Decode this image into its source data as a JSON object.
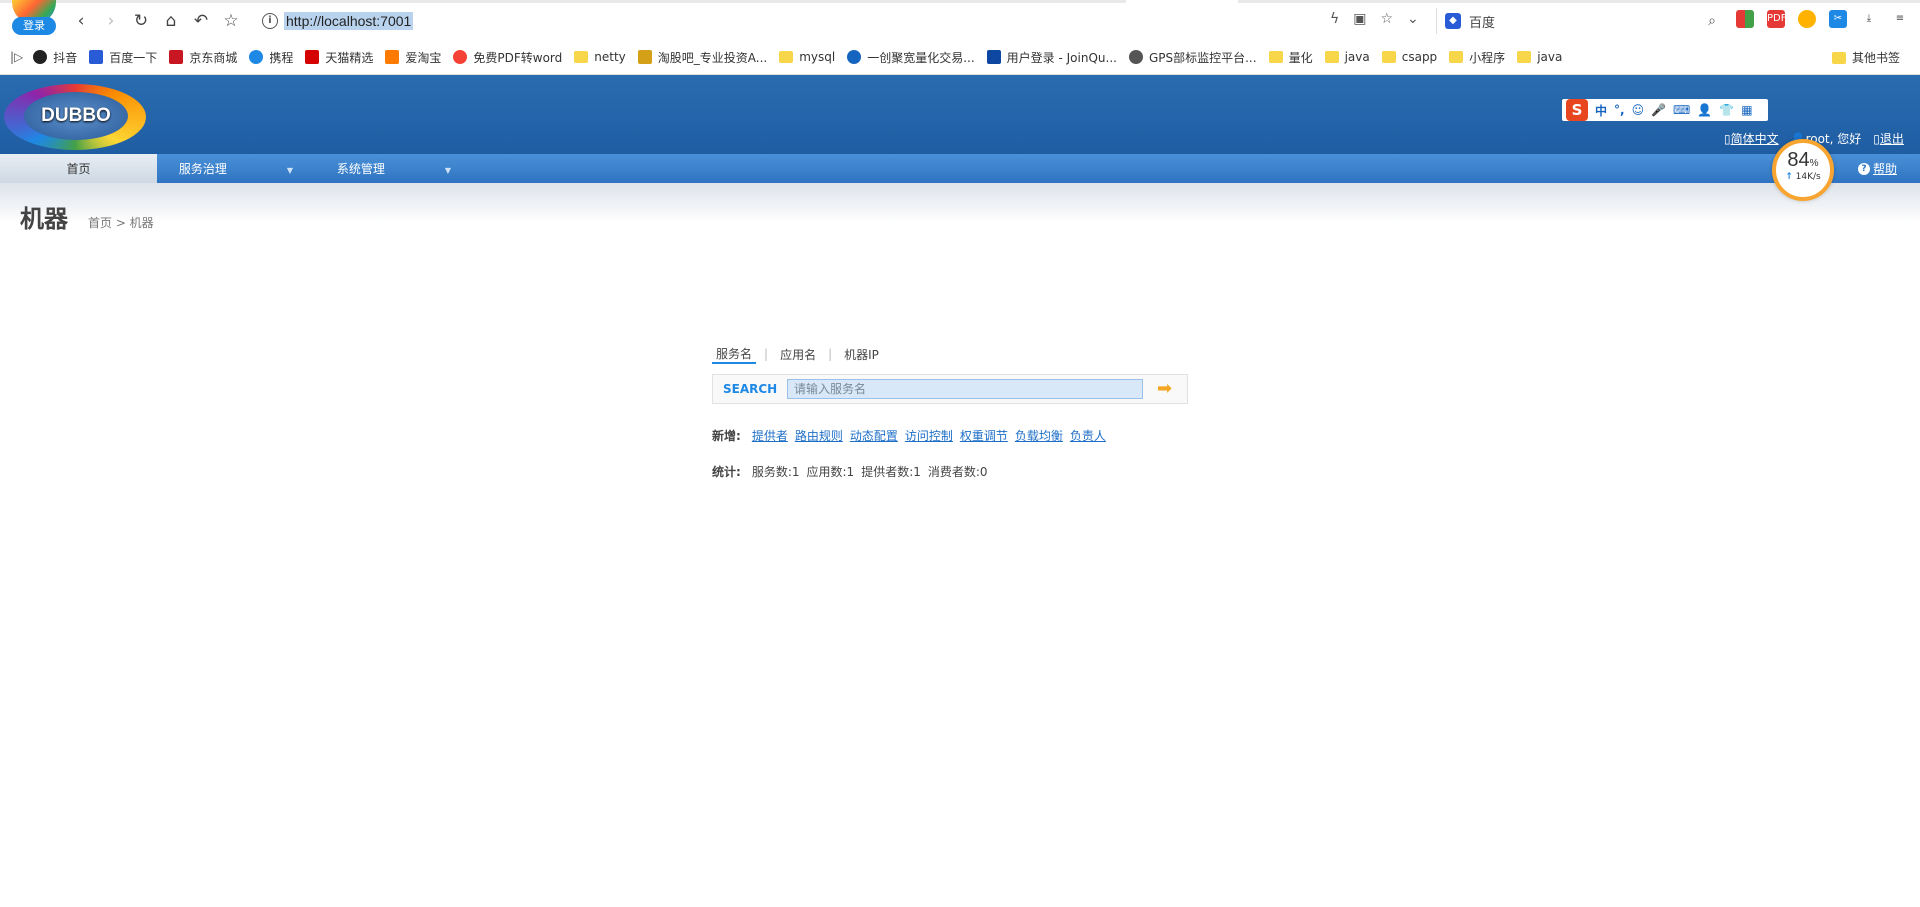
{
  "browser": {
    "login_label": "登录",
    "url": "http://localhost:7001",
    "search_engine": "百度",
    "bookmarks": [
      {
        "label": "抖音",
        "icon": "douyin-icon"
      },
      {
        "label": "百度一下",
        "icon": "baidu-icon"
      },
      {
        "label": "京东商城",
        "icon": "jd-icon"
      },
      {
        "label": "携程",
        "icon": "ctrip-icon"
      },
      {
        "label": "天猫精选",
        "icon": "tmall-icon"
      },
      {
        "label": "爱淘宝",
        "icon": "taobao-icon"
      },
      {
        "label": "免费PDF转word",
        "icon": "pdf-icon"
      },
      {
        "label": "netty",
        "icon": "folder-icon"
      },
      {
        "label": "淘股吧_专业投资A...",
        "icon": "taoguba-icon"
      },
      {
        "label": "mysql",
        "icon": "folder-icon"
      },
      {
        "label": "一创聚宽量化交易...",
        "icon": "joinquant-icon"
      },
      {
        "label": "用户登录 - JoinQu...",
        "icon": "joinquant-chart-icon"
      },
      {
        "label": "GPS部标监控平台...",
        "icon": "globe-icon"
      },
      {
        "label": "量化",
        "icon": "folder-icon"
      },
      {
        "label": "java",
        "icon": "folder-icon"
      },
      {
        "label": "csapp",
        "icon": "folder-icon"
      },
      {
        "label": "小程序",
        "icon": "folder-icon"
      },
      {
        "label": "java",
        "icon": "folder-icon"
      }
    ],
    "other_bookmarks": "其他书签"
  },
  "header": {
    "logo_text": "DUBBO",
    "lang_label": "简体中文",
    "greeting": "root, 您好",
    "logout_label": "退出",
    "help_label": "帮助"
  },
  "ime": {
    "items": [
      "中",
      "°,",
      "☺",
      "🎤",
      "⌨",
      "👤",
      "👕",
      "▦"
    ]
  },
  "menu": {
    "home": "首页",
    "service_governance": "服务治理",
    "system_management": "系统管理"
  },
  "gauge": {
    "percent": "84",
    "percent_unit": "%",
    "speed": "14K/s"
  },
  "page": {
    "title": "机器",
    "breadcrumb": "首页 > 机器"
  },
  "search": {
    "tabs": [
      "服务名",
      "应用名",
      "机器IP"
    ],
    "label": "SEARCH",
    "placeholder": "请输入服务名"
  },
  "new": {
    "label": "新增:",
    "links": [
      "提供者",
      "路由规则",
      "动态配置",
      "访问控制",
      "权重调节",
      "负载均衡",
      "负责人"
    ]
  },
  "stats": {
    "label": "统计:",
    "items": [
      "服务数:1",
      "应用数:1",
      "提供者数:1",
      "消费者数:0"
    ]
  }
}
